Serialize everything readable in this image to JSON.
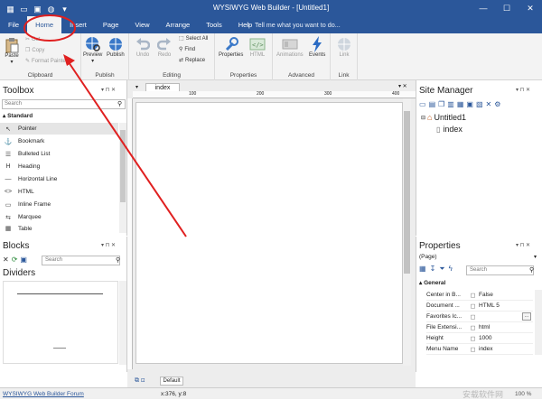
{
  "app": {
    "window_title": "WYSIWYG Web Builder - [Untitled1]",
    "tell_me": "Tell me what you want to do..."
  },
  "menus": [
    "File",
    "Home",
    "Insert",
    "Page",
    "View",
    "Arrange",
    "Tools",
    "Help"
  ],
  "ribbon": {
    "clipboard": {
      "label": "Clipboard",
      "paste": "Paste",
      "cut": "Cut",
      "copy": "Copy",
      "format_painter": "Format Painter"
    },
    "publish": {
      "label": "Publish",
      "preview": "Preview",
      "publish": "Publish"
    },
    "editing": {
      "label": "Editing",
      "undo": "Undo",
      "redo": "Redo",
      "select_all": "Select All",
      "find": "Find",
      "replace": "Replace"
    },
    "properties": {
      "label": "Properties",
      "properties": "Properties",
      "html": "HTML"
    },
    "advanced": {
      "label": "Advanced",
      "animations": "Animations",
      "events": "Events"
    },
    "link": {
      "label": "Link",
      "link": "Link"
    }
  },
  "toolbox": {
    "title": "Toolbox",
    "search_placeholder": "Search",
    "category": "Standard",
    "items": [
      {
        "label": "Pointer",
        "icon": "pointer-icon"
      },
      {
        "label": "Bookmark",
        "icon": "anchor-icon"
      },
      {
        "label": "Bulleted List",
        "icon": "bulleted-list-icon"
      },
      {
        "label": "Heading",
        "icon": "heading-icon"
      },
      {
        "label": "Horizontal Line",
        "icon": "horizontal-line-icon"
      },
      {
        "label": "HTML",
        "icon": "html-icon"
      },
      {
        "label": "Inline Frame",
        "icon": "inline-frame-icon"
      },
      {
        "label": "Marquee",
        "icon": "marquee-icon"
      },
      {
        "label": "Table",
        "icon": "table-icon"
      }
    ]
  },
  "blocks": {
    "title": "Blocks",
    "search_placeholder": "Search",
    "category": "Dividers"
  },
  "editor": {
    "tab": "index",
    "page_tab": "Default",
    "ruler": [
      "100",
      "200",
      "300",
      "400"
    ]
  },
  "site_manager": {
    "title": "Site Manager",
    "root": "Untitled1",
    "page": "index"
  },
  "properties": {
    "title": "Properties",
    "object": "(Page)",
    "search_placeholder": "Search",
    "section": "General",
    "rows": [
      {
        "name": "Center in B...",
        "value": "False"
      },
      {
        "name": "Document ...",
        "value": "HTML 5"
      },
      {
        "name": "Favorites Ic...",
        "value": ""
      },
      {
        "name": "File Extensi...",
        "value": "html"
      },
      {
        "name": "Height",
        "value": "1000"
      },
      {
        "name": "Menu Name",
        "value": "index"
      }
    ]
  },
  "status": {
    "left": "WYSIWYG Web Builder Forum",
    "coords": "x:376, y:8",
    "zoom": "100 %",
    "watermark": "安载软件网"
  },
  "colors": {
    "title_bar": "#2b579a",
    "ribbon": "#f3f3f3",
    "annotation": "#e02020"
  }
}
